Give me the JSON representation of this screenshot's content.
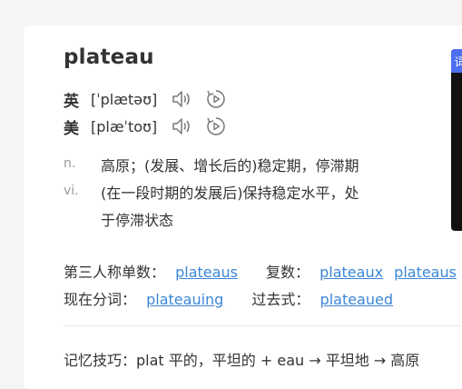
{
  "word": "plateau",
  "pronunciations": [
    {
      "lang": "英",
      "ipa": "[ˈplætəʊ]",
      "sound_icon": "speaker-icon",
      "replay_icon": "replay-icon"
    },
    {
      "lang": "美",
      "ipa": "[plæˈtoʊ]",
      "sound_icon": "speaker-icon",
      "replay_icon": "replay-icon"
    }
  ],
  "definitions": [
    {
      "pos": "n.",
      "lines": [
        "高原；(发展、增长后的)稳定期，停滞期"
      ]
    },
    {
      "pos": "vi.",
      "lines": [
        "(在一段时期的发展后)保持稳定水平，处",
        "于停滞状态"
      ]
    }
  ],
  "forms": {
    "third_person_label": "第三人称单数：",
    "third_person": "plateaus",
    "plural_label": "复数：",
    "plural": [
      "plateaux",
      "plateaus"
    ],
    "present_participle_label": "现在分词：",
    "present_participle": "plateauing",
    "past_label": "过去式：",
    "past": "plateaued"
  },
  "memory_tip": "记忆技巧：plat 平的，平坦的 + eau → 平坦地 → 高原",
  "side_tab_label": "词",
  "colors": {
    "link": "#3b86d8",
    "accent": "#4e6ef2",
    "text": "#333333",
    "muted": "#999999"
  }
}
